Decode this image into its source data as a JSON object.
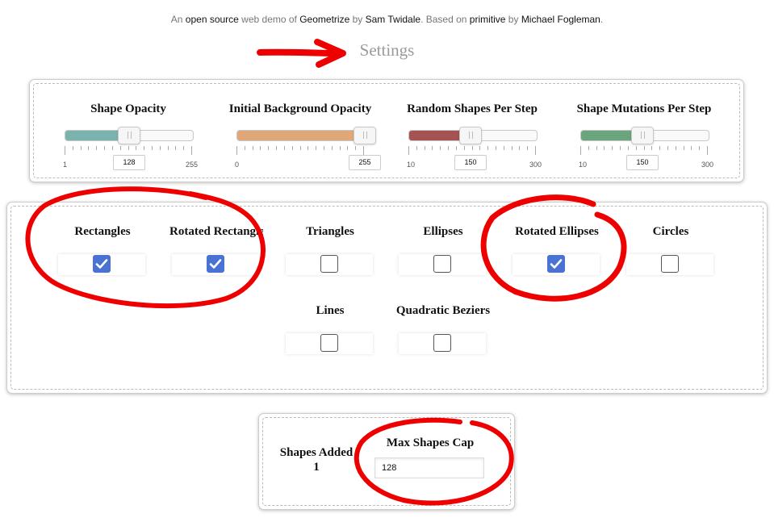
{
  "credits": {
    "p1": "An ",
    "open_source": "open source",
    "p2": " web demo of ",
    "geometrize": "Geometrize",
    "p3": " by ",
    "author": "Sam Twidale",
    "p4": ". Based on ",
    "primitive": "primitive",
    "p5": " by ",
    "primitive_author": "Michael Fogleman",
    "p6": "."
  },
  "settings_title": "Settings",
  "sliders": [
    {
      "title": "Shape Opacity",
      "min": "1",
      "max": "255",
      "value": "128",
      "fraction": 0.5,
      "color": "#7ab3ad"
    },
    {
      "title": "Initial Background Opacity",
      "min": "0",
      "max": "255",
      "value": "255",
      "fraction": 1.0,
      "color": "#e0a878"
    },
    {
      "title": "Random Shapes Per Step",
      "min": "10",
      "max": "300",
      "value": "150",
      "fraction": 0.48,
      "color": "#a55252"
    },
    {
      "title": "Shape Mutations Per Step",
      "min": "10",
      "max": "300",
      "value": "150",
      "fraction": 0.48,
      "color": "#6aa57c"
    }
  ],
  "shapes": [
    {
      "label": "Rectangles",
      "checked": true
    },
    {
      "label": "Rotated Rectangles",
      "checked": true
    },
    {
      "label": "Triangles",
      "checked": false
    },
    {
      "label": "Ellipses",
      "checked": false
    },
    {
      "label": "Rotated Ellipses",
      "checked": true
    },
    {
      "label": "Circles",
      "checked": false
    },
    {
      "label": "Lines",
      "checked": false
    },
    {
      "label": "Quadratic Beziers",
      "checked": false
    }
  ],
  "stats": {
    "shapes_added_label": "Shapes Added",
    "shapes_added_value": "1",
    "max_shapes_label": "Max Shapes Cap",
    "max_shapes_value": "128"
  },
  "colors": {
    "annotation_red": "#ee0000",
    "checkbox_blue": "#4a72d4"
  }
}
